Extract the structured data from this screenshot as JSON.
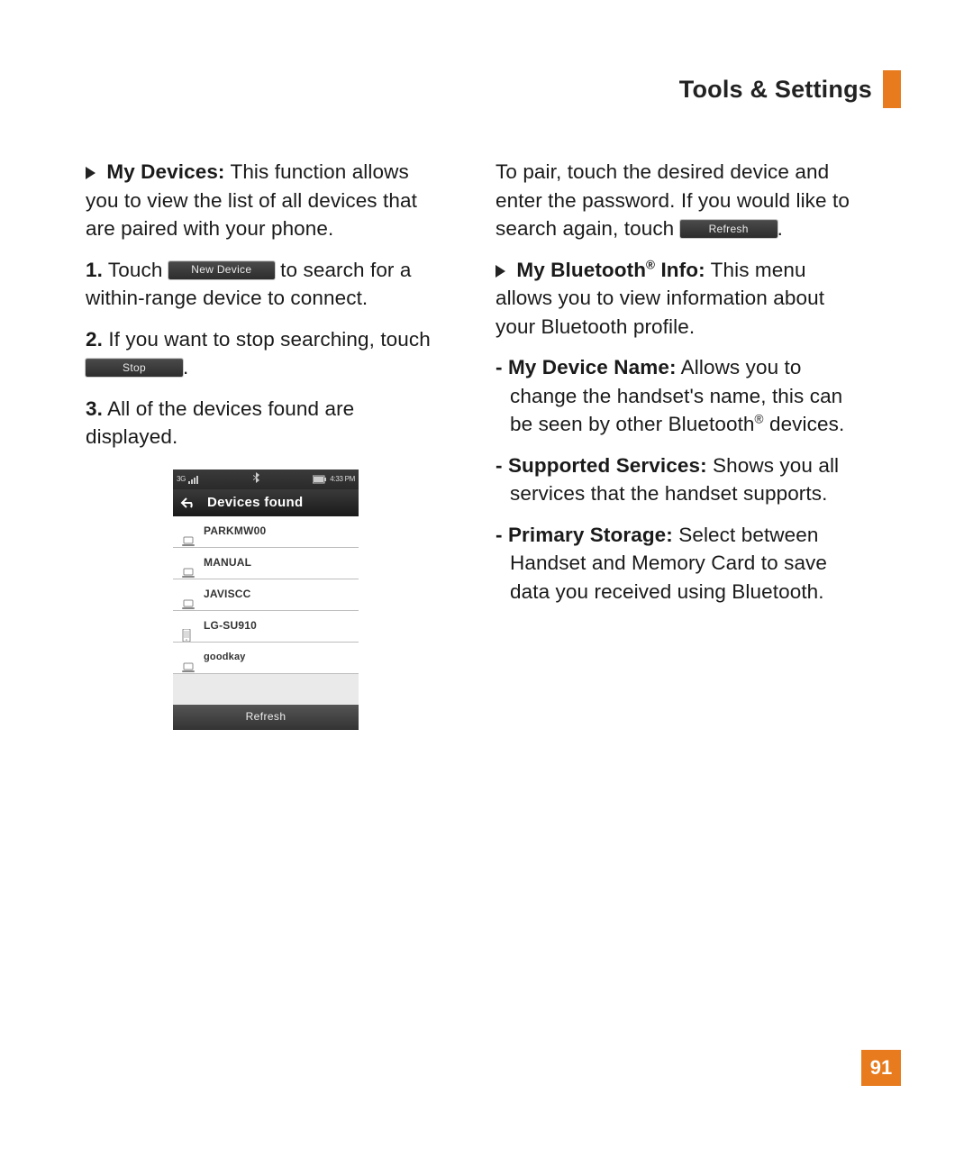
{
  "header": {
    "title": "Tools & Settings"
  },
  "left": {
    "myDevices": {
      "label": "My Devices:",
      "text": " This function allows you to view the list of all devices that are paired with your phone."
    },
    "step1": {
      "n": "1.",
      "pre": " Touch ",
      "btn": "New Device",
      "post": " to search for a within-range device to connect."
    },
    "step2": {
      "n": "2.",
      "pre": " If you want to stop searching, touch ",
      "btn": "Stop",
      "post": "."
    },
    "step3": {
      "n": "3.",
      "text": " All of the devices found are displayed."
    }
  },
  "phone": {
    "status": {
      "left_net": "3G",
      "bt": "✱",
      "time": "4:33 PM"
    },
    "title": "Devices found",
    "devices": [
      "PARKMW00",
      "MANUAL",
      "JAVISCC",
      "LG-SU910",
      "goodkay"
    ],
    "device_types": [
      "laptop",
      "laptop",
      "laptop",
      "phone",
      "laptop"
    ],
    "refresh": "Refresh"
  },
  "right": {
    "pair": {
      "pre": "To pair, touch the desired device and enter the password. If you would like to search again, touch ",
      "btn": "Refresh",
      "post": "."
    },
    "btInfo": {
      "label_a": "My Bluetooth",
      "label_b": " Info:",
      "text": " This menu allows you to view information about your Bluetooth profile."
    },
    "items": {
      "name": {
        "label": "My Device Name:",
        "text": " Allows you to change the handset's name, this can be seen by other Bluetooth",
        "tail": " devices."
      },
      "services": {
        "label": "Supported Services:",
        "text": " Shows you all services that the handset supports."
      },
      "storage": {
        "label": "Primary Storage:",
        "text": " Select between Handset and Memory Card to save data you received using Bluetooth."
      }
    }
  },
  "page_number": "91"
}
